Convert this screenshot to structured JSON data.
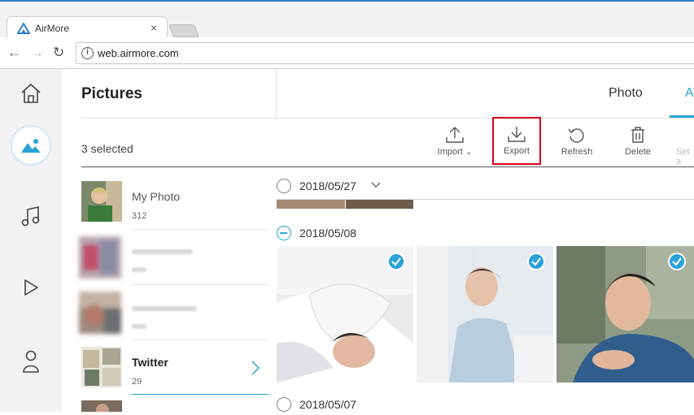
{
  "browser": {
    "tab_title": "AirMore",
    "close_glyph": "×",
    "url": "web.airmore.com",
    "back_glyph": "←",
    "forward_glyph": "→",
    "reload_glyph": "↻",
    "info_glyph": "i"
  },
  "sidebar": {
    "items": [
      {
        "icon": "home-icon"
      },
      {
        "icon": "pictures-icon",
        "active": true
      },
      {
        "icon": "music-icon"
      },
      {
        "icon": "video-icon"
      },
      {
        "icon": "contacts-icon"
      }
    ]
  },
  "header": {
    "title": "Pictures",
    "tabs": [
      {
        "label": "Photo"
      },
      {
        "label": "A"
      }
    ]
  },
  "toolbar": {
    "selected_text": "3 selected",
    "import_label": "Import",
    "export_label": "Export",
    "refresh_label": "Refresh",
    "delete_label": "Delete",
    "set_label": "Set a"
  },
  "albums": [
    {
      "name": "My Photo",
      "count": "312"
    },
    {
      "name": "",
      "count": ""
    },
    {
      "name": "",
      "count": ""
    },
    {
      "name": "Twitter",
      "count": "29"
    }
  ],
  "dates": [
    {
      "label": "2018/05/27"
    },
    {
      "label": "2018/05/08"
    },
    {
      "label": "2018/05/07"
    }
  ],
  "colors": {
    "accent": "#2aa3d8",
    "export_highlight": "#d9001b"
  }
}
